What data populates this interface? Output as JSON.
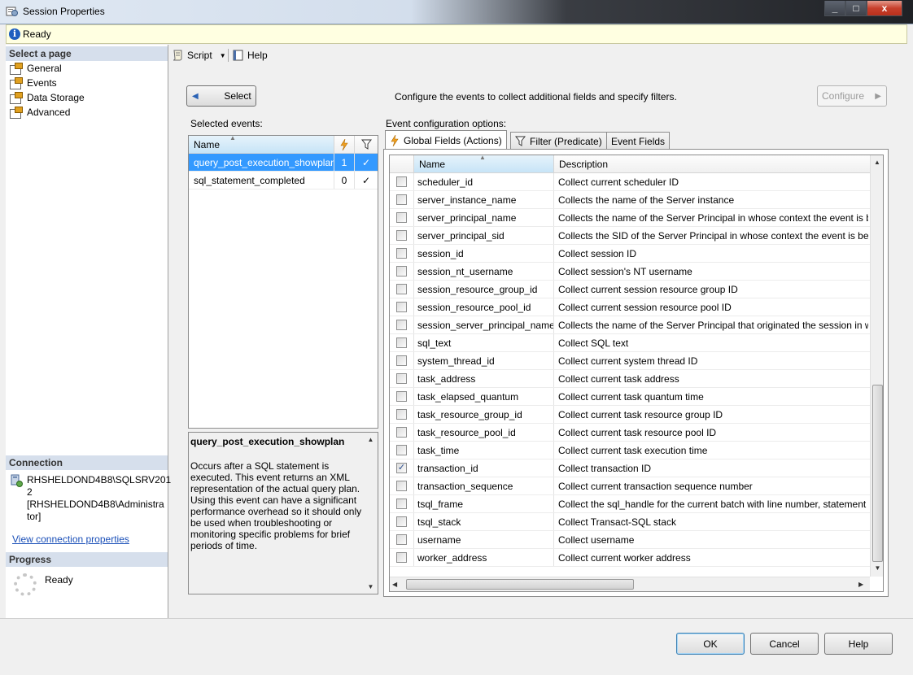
{
  "window": {
    "title": "Session Properties",
    "controls": {
      "minimize": "_",
      "maximize": "□",
      "close": "x"
    }
  },
  "status": {
    "text": "Ready"
  },
  "left": {
    "select_page_header": "Select a page",
    "pages": [
      {
        "label": "General"
      },
      {
        "label": "Events"
      },
      {
        "label": "Data Storage"
      },
      {
        "label": "Advanced"
      }
    ],
    "connection_header": "Connection",
    "connection_lines": [
      "RHSHELDOND4B8\\SQLSRV201",
      "2",
      "[RHSHELDOND4B8\\Administra",
      "tor]"
    ],
    "view_connection": "View connection properties",
    "progress_header": "Progress",
    "progress_status": "Ready"
  },
  "toolbar": {
    "script": "Script",
    "help": "Help"
  },
  "main": {
    "select_button": "Select",
    "configure_text": "Configure the events to collect additional fields and specify filters.",
    "configure_button": "Configure",
    "selected_events_label": "Selected events:",
    "event_config_label": "Event configuration options:",
    "events_header": {
      "name": "Name"
    },
    "events": [
      {
        "name": "query_post_execution_showplan",
        "actions": "1",
        "filter": "✓",
        "selected": true
      },
      {
        "name": "sql_statement_completed",
        "actions": "0",
        "filter": "✓",
        "selected": false
      }
    ],
    "description_title": "query_post_execution_showplan",
    "description_body": "Occurs after a SQL statement is executed. This event returns an XML representation of the actual query plan. Using this event can have a significant performance overhead so it should only be used when troubleshooting or monitoring specific problems for brief periods of time.",
    "tabs": [
      {
        "label": "Global Fields (Actions)"
      },
      {
        "label": "Filter (Predicate)"
      },
      {
        "label": "Event Fields"
      }
    ],
    "fields_header": {
      "name": "Name",
      "description": "Description"
    },
    "fields": [
      {
        "name": "scheduler_id",
        "description": "Collect current scheduler ID",
        "checked": false
      },
      {
        "name": "server_instance_name",
        "description": "Collects the name of the Server instance",
        "checked": false
      },
      {
        "name": "server_principal_name",
        "description": "Collects the name of the Server Principal in whose context the event is be",
        "checked": false
      },
      {
        "name": "server_principal_sid",
        "description": "Collects the SID of the Server Principal in whose context the event is bein",
        "checked": false
      },
      {
        "name": "session_id",
        "description": "Collect session ID",
        "checked": false
      },
      {
        "name": "session_nt_username",
        "description": "Collect session's NT username",
        "checked": false
      },
      {
        "name": "session_resource_group_id",
        "description": "Collect current session resource group ID",
        "checked": false
      },
      {
        "name": "session_resource_pool_id",
        "description": "Collect current session resource pool ID",
        "checked": false
      },
      {
        "name": "session_server_principal_name",
        "description": "Collects the name of the Server Principal that originated the session in w",
        "checked": false
      },
      {
        "name": "sql_text",
        "description": "Collect SQL text",
        "checked": false
      },
      {
        "name": "system_thread_id",
        "description": "Collect current system thread ID",
        "checked": false
      },
      {
        "name": "task_address",
        "description": "Collect current task address",
        "checked": false
      },
      {
        "name": "task_elapsed_quantum",
        "description": "Collect current task quantum time",
        "checked": false
      },
      {
        "name": "task_resource_group_id",
        "description": "Collect current task resource group ID",
        "checked": false
      },
      {
        "name": "task_resource_pool_id",
        "description": "Collect current task resource pool ID",
        "checked": false
      },
      {
        "name": "task_time",
        "description": "Collect current task execution time",
        "checked": false
      },
      {
        "name": "transaction_id",
        "description": "Collect transaction ID",
        "checked": true
      },
      {
        "name": "transaction_sequence",
        "description": "Collect current transaction sequence number",
        "checked": false
      },
      {
        "name": "tsql_frame",
        "description": "Collect the sql_handle for the current batch with line number, statement",
        "checked": false
      },
      {
        "name": "tsql_stack",
        "description": "Collect Transact-SQL stack",
        "checked": false
      },
      {
        "name": "username",
        "description": "Collect username",
        "checked": false
      },
      {
        "name": "worker_address",
        "description": "Collect current worker address",
        "checked": false
      }
    ]
  },
  "buttons": {
    "ok": "OK",
    "cancel": "Cancel",
    "help": "Help"
  },
  "colors": {
    "selection": "#3399ff",
    "link": "#1a4fb8",
    "status_bg": "#ffffe1",
    "header_bg": "#d6dfec"
  }
}
